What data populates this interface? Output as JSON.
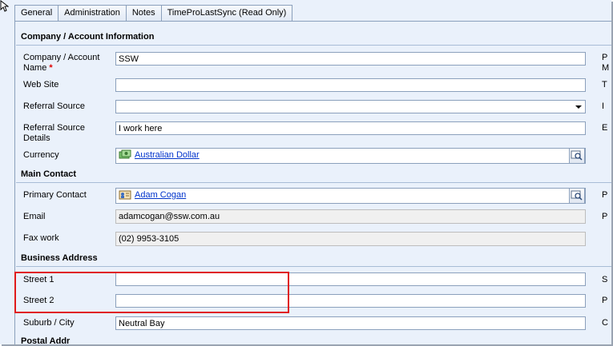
{
  "tabs": [
    "General",
    "Administration",
    "Notes",
    "TimeProLastSync (Read Only)"
  ],
  "sections": {
    "company": "Company / Account Information",
    "contact": "Main Contact",
    "address": "Business Address",
    "postal": "Postal Addr"
  },
  "fields": {
    "company_name": {
      "label_line1": "Company / Account",
      "label_line2": "Name",
      "required_mark": "*",
      "value": "SSW"
    },
    "web_site": {
      "label": "Web Site",
      "value": ""
    },
    "referral_source": {
      "label": "Referral Source",
      "value": ""
    },
    "referral_details": {
      "label_line1": "Referral Source",
      "label_line2": "Details",
      "value": "I work here"
    },
    "currency": {
      "label": "Currency",
      "value": "Australian Dollar"
    },
    "primary_contact": {
      "label": "Primary Contact",
      "value": "Adam Cogan"
    },
    "email": {
      "label": "Email",
      "value": "adamcogan@ssw.com.au"
    },
    "fax_work": {
      "label": "Fax work",
      "value": "(02) 9953-3105"
    },
    "street1": {
      "label": "Street 1",
      "value": ""
    },
    "street2": {
      "label": "Street 2",
      "value": ""
    },
    "suburb": {
      "label": "Suburb / City",
      "value": "Neutral Bay"
    }
  },
  "right_column_letters": [
    "P",
    "M",
    "T",
    "I",
    "E",
    "P",
    "P",
    "S",
    "P",
    "C"
  ],
  "highlight_color": "#e01b1b"
}
